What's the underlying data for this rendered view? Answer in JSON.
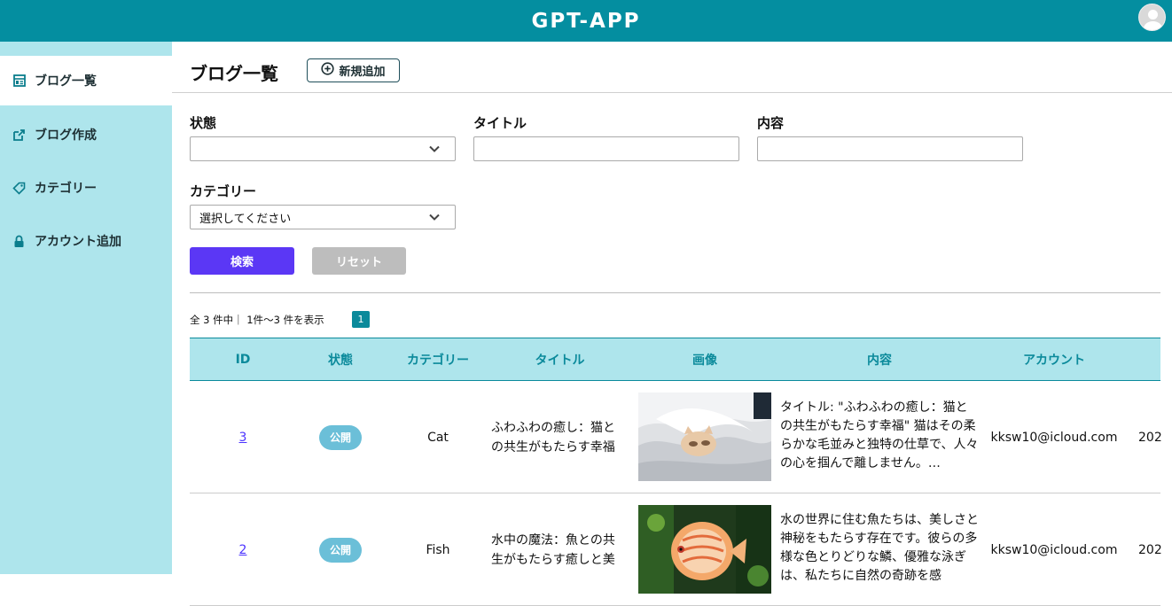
{
  "app": {
    "title": "GPT-APP"
  },
  "sidebar": {
    "items": [
      {
        "label": "ブログ一覧",
        "icon": "list-icon"
      },
      {
        "label": "ブログ作成",
        "icon": "edit-icon"
      },
      {
        "label": "カテゴリー",
        "icon": "tag-icon"
      },
      {
        "label": "アカウント追加",
        "icon": "lock-icon"
      }
    ]
  },
  "page": {
    "title": "ブログ一覧",
    "new_button": "新規追加"
  },
  "filters": {
    "status_label": "状態",
    "status_value": "",
    "title_label": "タイトル",
    "content_label": "内容",
    "category_label": "カテゴリー",
    "category_placeholder": "選択してください",
    "search_button": "検索",
    "reset_button": "リセット"
  },
  "pagination": {
    "summary": "全 3 件中｜ 1件〜3 件を表示",
    "current_page": "1"
  },
  "table": {
    "headers": [
      "ID",
      "状態",
      "カテゴリー",
      "タイトル",
      "画像",
      "内容",
      "アカウント"
    ],
    "rows": [
      {
        "id": "3",
        "status": "公開",
        "category": "Cat",
        "title": "ふわふわの癒し：猫との共生がもたらす幸福",
        "content": "タイトル: \"ふわふわの癒し：猫との共生がもたらす幸福\" 猫はその柔らかな毛並みと独特の仕草で、人々の心を掴んで離しません。…",
        "account": "kksw10@icloud.com",
        "date": "202"
      },
      {
        "id": "2",
        "status": "公開",
        "category": "Fish",
        "title": "水中の魔法：魚との共生がもたらす癒しと美",
        "content": "水の世界に住む魚たちは、美しさと神秘をもたらす存在です。彼らの多様な色とりどりな鱗、優雅な泳ぎは、私たちに自然の奇跡を感",
        "account": "kksw10@icloud.com",
        "date": "202"
      }
    ]
  },
  "colors": {
    "header": "#048ea0",
    "sidebar": "#aee5ec",
    "primary": "#5b37f5",
    "badge": "#6bbfd8"
  }
}
